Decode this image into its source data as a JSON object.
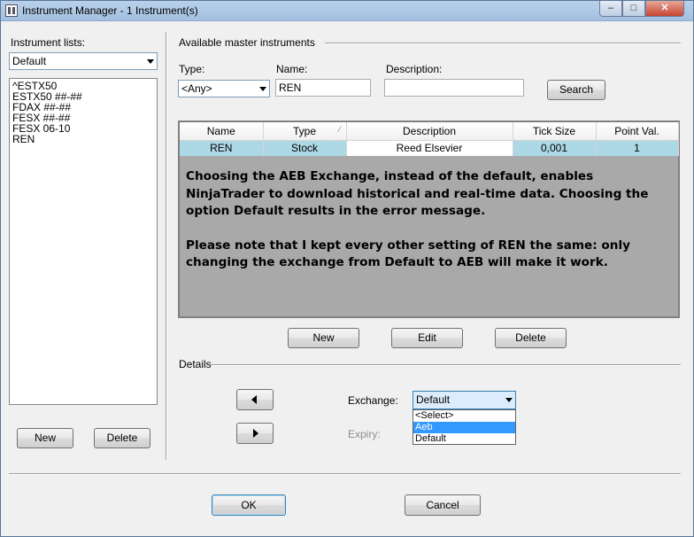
{
  "window": {
    "title": "Instrument Manager - 1 Instrument(s)",
    "min": "–",
    "max": "□",
    "close": "✕"
  },
  "left": {
    "lists_label": "Instrument lists:",
    "list_selected": "Default",
    "instruments": [
      "^ESTX50",
      "ESTX50 ##-##",
      "FDAX ##-##",
      "FESX ##-##",
      "FESX 06-10",
      "REN"
    ],
    "new_label": "New",
    "delete_label": "Delete"
  },
  "master": {
    "section_label": "Available master instruments",
    "type_label": "Type:",
    "type_value": "<Any>",
    "name_label": "Name:",
    "name_value": "REN",
    "desc_label": "Description:",
    "desc_value": "",
    "search_label": "Search",
    "columns": [
      "Name",
      "Type",
      "Description",
      "Tick Size",
      "Point Val."
    ],
    "rows": [
      {
        "name": "REN",
        "type": "Stock",
        "description": "Reed Elsevier",
        "tick_size": "0,001",
        "point_value": "1"
      }
    ],
    "note_1": "Choosing the AEB Exchange, instead of the default, enables NinjaTrader to download historical and real-time data. Choosing the option Default results in the error message.",
    "note_2": "Please note that I kept every other setting of REN the same: only changing the exchange from Default to AEB will make it work.",
    "new_label": "New",
    "edit_label": "Edit",
    "delete_label": "Delete"
  },
  "details": {
    "section_label": "Details",
    "exchange_label": "Exchange:",
    "exchange_value": "Default",
    "exchange_options": [
      "<Select>",
      "Aeb",
      "Default"
    ],
    "exchange_highlighted": "Aeb",
    "expiry_label": "Expiry:"
  },
  "footer": {
    "ok_label": "OK",
    "cancel_label": "Cancel"
  },
  "colors": {
    "selected_row": "#add8e6",
    "grid_bg": "#a9a9a9",
    "dropdown_highlight": "#3399ff"
  }
}
